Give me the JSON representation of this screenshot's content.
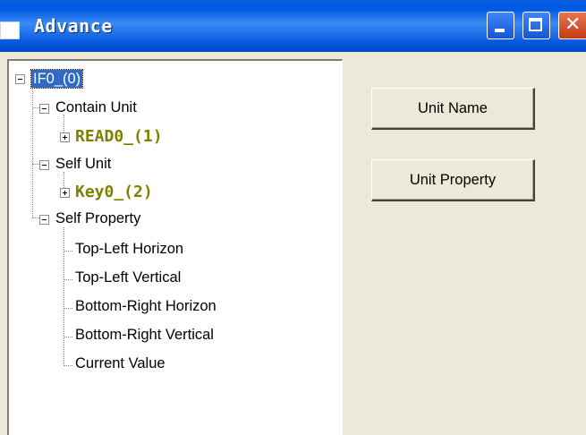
{
  "window": {
    "title": "Advance"
  },
  "tree": {
    "root": "IF0_(0)",
    "contain_unit": "Contain Unit",
    "contain_child": "READ0_(1)",
    "self_unit": "Self Unit",
    "self_unit_child": "Key0_(2)",
    "self_property": "Self Property",
    "property_items": [
      "Top-Left Horizon",
      "Top-Left Vertical",
      "Bottom-Right Horizon",
      "Bottom-Right Vertical",
      "Current Value"
    ]
  },
  "buttons": {
    "unit_name": "Unit Name",
    "unit_property": "Unit Property"
  },
  "colors": {
    "titlebar": "#0058e6",
    "selection": "#316ac5",
    "child_text": "#808000",
    "face": "#ece9d8"
  }
}
